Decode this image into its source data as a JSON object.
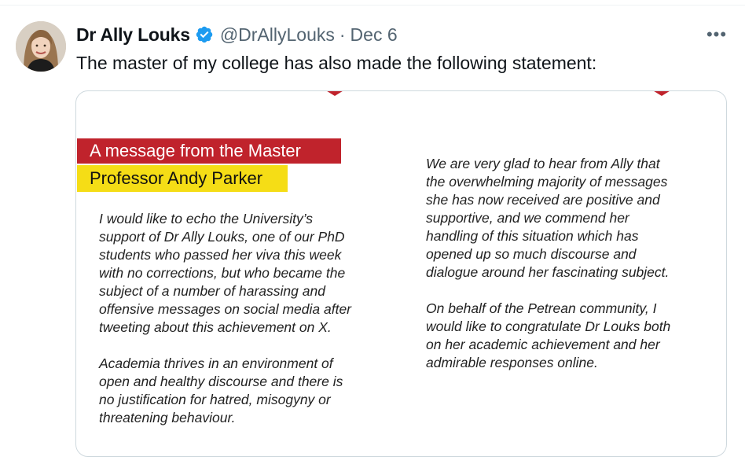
{
  "tweet": {
    "author": {
      "display_name": "Dr Ally Louks",
      "verified": true,
      "verified_icon": "verified-badge-icon",
      "handle": "@DrAllyLouks",
      "separator": "·",
      "date": "Dec 6"
    },
    "more_icon": "more-options-icon",
    "more_label": "•••",
    "text": "The master of my college has also made the following statement:"
  },
  "statement_image": {
    "banner_title": "A message from the Master",
    "banner_name": "Professor Andy Parker",
    "left_column": [
      [
        "I would like to echo the University’s",
        "support of Dr Ally Louks, one of our PhD",
        "students who passed her viva this week",
        "with no corrections, but who became the",
        "subject of a number of harassing and",
        "offensive messages on social media after",
        "tweeting about this achievement on X."
      ],
      [
        "Academia thrives in an environment of",
        "open and healthy discourse and there is",
        "no justification for hatred, misogyny or",
        "threatening behaviour."
      ]
    ],
    "right_column": [
      [
        "We are very glad to hear from Ally that",
        "the overwhelming majority of messages",
        "she has now received are positive and",
        "supportive, and we commend her",
        "handling of this situation which has",
        "opened up so much discourse and",
        "dialogue around her fascinating subject."
      ],
      [
        "On behalf of the Petrean community, I",
        "would like to congratulate Dr Louks both",
        "on her academic achievement and her",
        "admirable responses online."
      ]
    ]
  },
  "colors": {
    "text_primary": "#0f1419",
    "text_secondary": "#536471",
    "verified_blue": "#1d9bf0",
    "banner_red": "#c0232c",
    "banner_yellow": "#f5dd16",
    "media_border": "#cfd9de"
  }
}
